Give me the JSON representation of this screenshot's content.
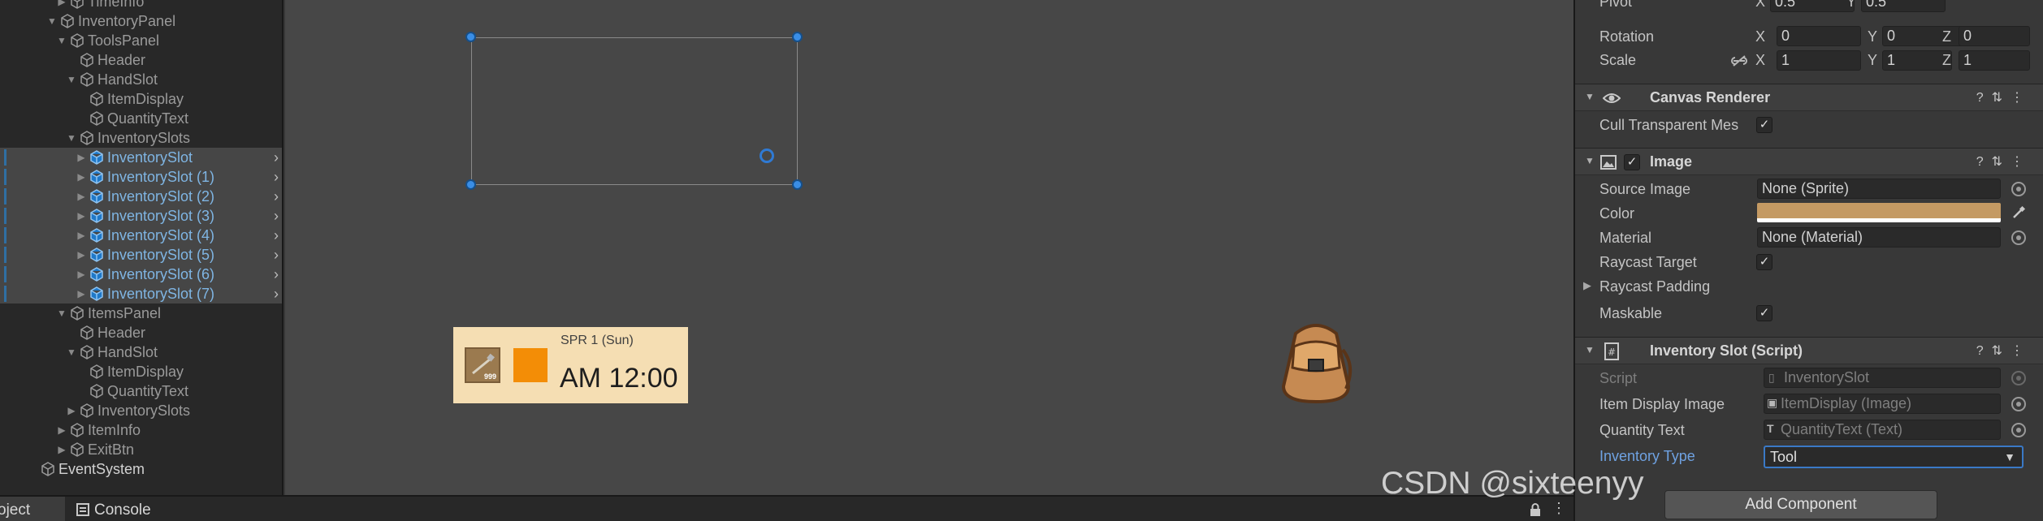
{
  "hierarchy": {
    "rows": [
      {
        "label": "TimeInfo",
        "indent": 5,
        "arrow": "▶",
        "selected": false
      },
      {
        "label": "InventoryPanel",
        "indent": 4,
        "arrow": "▼",
        "selected": false
      },
      {
        "label": "ToolsPanel",
        "indent": 5,
        "arrow": "▼",
        "selected": false
      },
      {
        "label": "Header",
        "indent": 6,
        "arrow": "",
        "selected": false
      },
      {
        "label": "HandSlot",
        "indent": 6,
        "arrow": "▼",
        "selected": false
      },
      {
        "label": "ItemDisplay",
        "indent": 7,
        "arrow": "",
        "selected": false
      },
      {
        "label": "QuantityText",
        "indent": 7,
        "arrow": "",
        "selected": false
      },
      {
        "label": "InventorySlots",
        "indent": 6,
        "arrow": "▼",
        "selected": false
      },
      {
        "label": "InventorySlot",
        "indent": 7,
        "arrow": "▶",
        "selected": true
      },
      {
        "label": "InventorySlot (1)",
        "indent": 7,
        "arrow": "▶",
        "selected": true
      },
      {
        "label": "InventorySlot (2)",
        "indent": 7,
        "arrow": "▶",
        "selected": true
      },
      {
        "label": "InventorySlot (3)",
        "indent": 7,
        "arrow": "▶",
        "selected": true
      },
      {
        "label": "InventorySlot (4)",
        "indent": 7,
        "arrow": "▶",
        "selected": true
      },
      {
        "label": "InventorySlot (5)",
        "indent": 7,
        "arrow": "▶",
        "selected": true
      },
      {
        "label": "InventorySlot (6)",
        "indent": 7,
        "arrow": "▶",
        "selected": true
      },
      {
        "label": "InventorySlot (7)",
        "indent": 7,
        "arrow": "▶",
        "selected": true
      },
      {
        "label": "ItemsPanel",
        "indent": 5,
        "arrow": "▼",
        "selected": false
      },
      {
        "label": "Header",
        "indent": 6,
        "arrow": "",
        "selected": false
      },
      {
        "label": "HandSlot",
        "indent": 6,
        "arrow": "▼",
        "selected": false
      },
      {
        "label": "ItemDisplay",
        "indent": 7,
        "arrow": "",
        "selected": false
      },
      {
        "label": "QuantityText",
        "indent": 7,
        "arrow": "",
        "selected": false
      },
      {
        "label": "InventorySlots",
        "indent": 6,
        "arrow": "▶",
        "selected": false
      },
      {
        "label": "ItemInfo",
        "indent": 5,
        "arrow": "▶",
        "selected": false
      },
      {
        "label": "ExitBtn",
        "indent": 5,
        "arrow": "▶",
        "selected": false
      },
      {
        "label": "EventSystem",
        "indent": 2,
        "arrow": "",
        "selected": false
      }
    ]
  },
  "bottom_bar": {
    "project_tab": "Project",
    "console_tab": "Console"
  },
  "scene": {
    "hud_date": "SPR 1 (Sun)",
    "hud_time": "AM 12:00",
    "hud_slot_quantity": "999"
  },
  "inspector": {
    "pivot_label": "Pivot",
    "pivot_x": "0.5",
    "pivot_y": "0.5",
    "rotation_label": "Rotation",
    "rotation_x": "0",
    "rotation_y": "0",
    "rotation_z": "0",
    "scale_label": "Scale",
    "scale_x": "1",
    "scale_y": "1",
    "scale_z": "1",
    "axis_x": "X",
    "axis_y": "Y",
    "axis_z": "Z",
    "canvas_renderer_title": "Canvas Renderer",
    "cull_label": "Cull Transparent Mes",
    "image_title": "Image",
    "source_image_label": "Source Image",
    "source_image_value": "None (Sprite)",
    "color_label": "Color",
    "color_value": "#c49a63",
    "material_label": "Material",
    "material_value": "None (Material)",
    "raycast_target_label": "Raycast Target",
    "raycast_padding_label": "Raycast Padding",
    "maskable_label": "Maskable",
    "script_component_title": "Inventory Slot (Script)",
    "script_label": "Script",
    "script_value": "InventorySlot",
    "item_display_label": "Item Display Image",
    "item_display_value": "ItemDisplay (Image)",
    "quantity_text_label": "Quantity Text",
    "quantity_text_value": "QuantityText (Text)",
    "inventory_type_label": "Inventory Type",
    "inventory_type_value": "Tool",
    "add_component": "Add Component"
  },
  "watermark": "CSDN @sixteenyy",
  "colors": {
    "selection_blue": "#3a8ee6",
    "hud_background": "#f5deb3",
    "hud_orange": "#f38d06"
  }
}
